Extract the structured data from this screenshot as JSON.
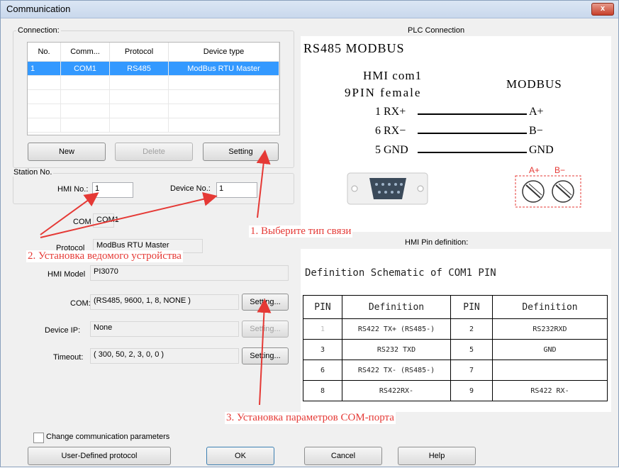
{
  "window": {
    "title": "Communication",
    "close_label": "x"
  },
  "connection": {
    "group_label": "Connection:",
    "columns": [
      "No.",
      "Comm...",
      "Protocol",
      "Device type"
    ],
    "rows": [
      {
        "no": "1",
        "comm": "COM1",
        "protocol": "RS485",
        "device_type": "ModBus RTU Master"
      }
    ],
    "new_label": "New",
    "delete_label": "Delete",
    "setting_label": "Setting"
  },
  "station": {
    "group_label": "Station No.",
    "hmi_no_label": "HMI No.:",
    "hmi_no_value": "1",
    "device_no_label": "Device No.:",
    "device_no_value": "1"
  },
  "details": {
    "com_label": "COM",
    "com_value": "COM1",
    "protocol_label": "Protocol",
    "protocol_value": "ModBus RTU Master",
    "hmi_model_label": "HMI Model",
    "hmi_model_value": "PI3070",
    "com_params_label": "COM:",
    "com_params_value": "(RS485, 9600, 1, 8, NONE )",
    "device_ip_label": "Device IP:",
    "device_ip_value": "None",
    "timeout_label": "Timeout:",
    "timeout_value": "( 300, 50, 2, 3, 0, 0 )",
    "setting_btn": "Setting...",
    "setting_btn_ip": "Setting...",
    "setting_btn_timeout": "Setting..."
  },
  "plc": {
    "header": "PLC Connection",
    "title": "RS485 MODBUS",
    "hmi_line1": "HMI com1",
    "hmi_line2": "9PIN female",
    "modbus": "MODBUS",
    "pins": [
      {
        "left": "1 RX+",
        "right": "A+"
      },
      {
        "left": "6 RX−",
        "right": "B−"
      },
      {
        "left": "5 GND",
        "right": "GND"
      }
    ],
    "terminal_a": "A+",
    "terminal_b": "B−"
  },
  "pin_def": {
    "header": "HMI Pin definition:",
    "title": "Definition Schematic of COM1 PIN",
    "head": [
      "PIN",
      "Definition",
      "PIN",
      "Definition"
    ],
    "rows": [
      [
        "1",
        "RS422 TX+ (RS485-)",
        "2",
        "RS232RXD"
      ],
      [
        "3",
        "RS232 TXD",
        "5",
        "GND"
      ],
      [
        "6",
        "RS422 TX- (RS485-)",
        "7",
        ""
      ],
      [
        "8",
        "RS422RX-",
        "9",
        "RS422 RX-"
      ]
    ]
  },
  "annotations": {
    "a1": "1. Выберите тип связи",
    "a2": "2. Установка ведомого устройства",
    "a3": "3. Установка параметров СОМ-порта"
  },
  "footer": {
    "checkbox_label": "Change communication parameters",
    "user_defined": "User-Defined protocol",
    "ok": "OK",
    "cancel": "Cancel",
    "help": "Help"
  },
  "colors": {
    "selection": "#3399ff",
    "annotation": "#e53935"
  }
}
